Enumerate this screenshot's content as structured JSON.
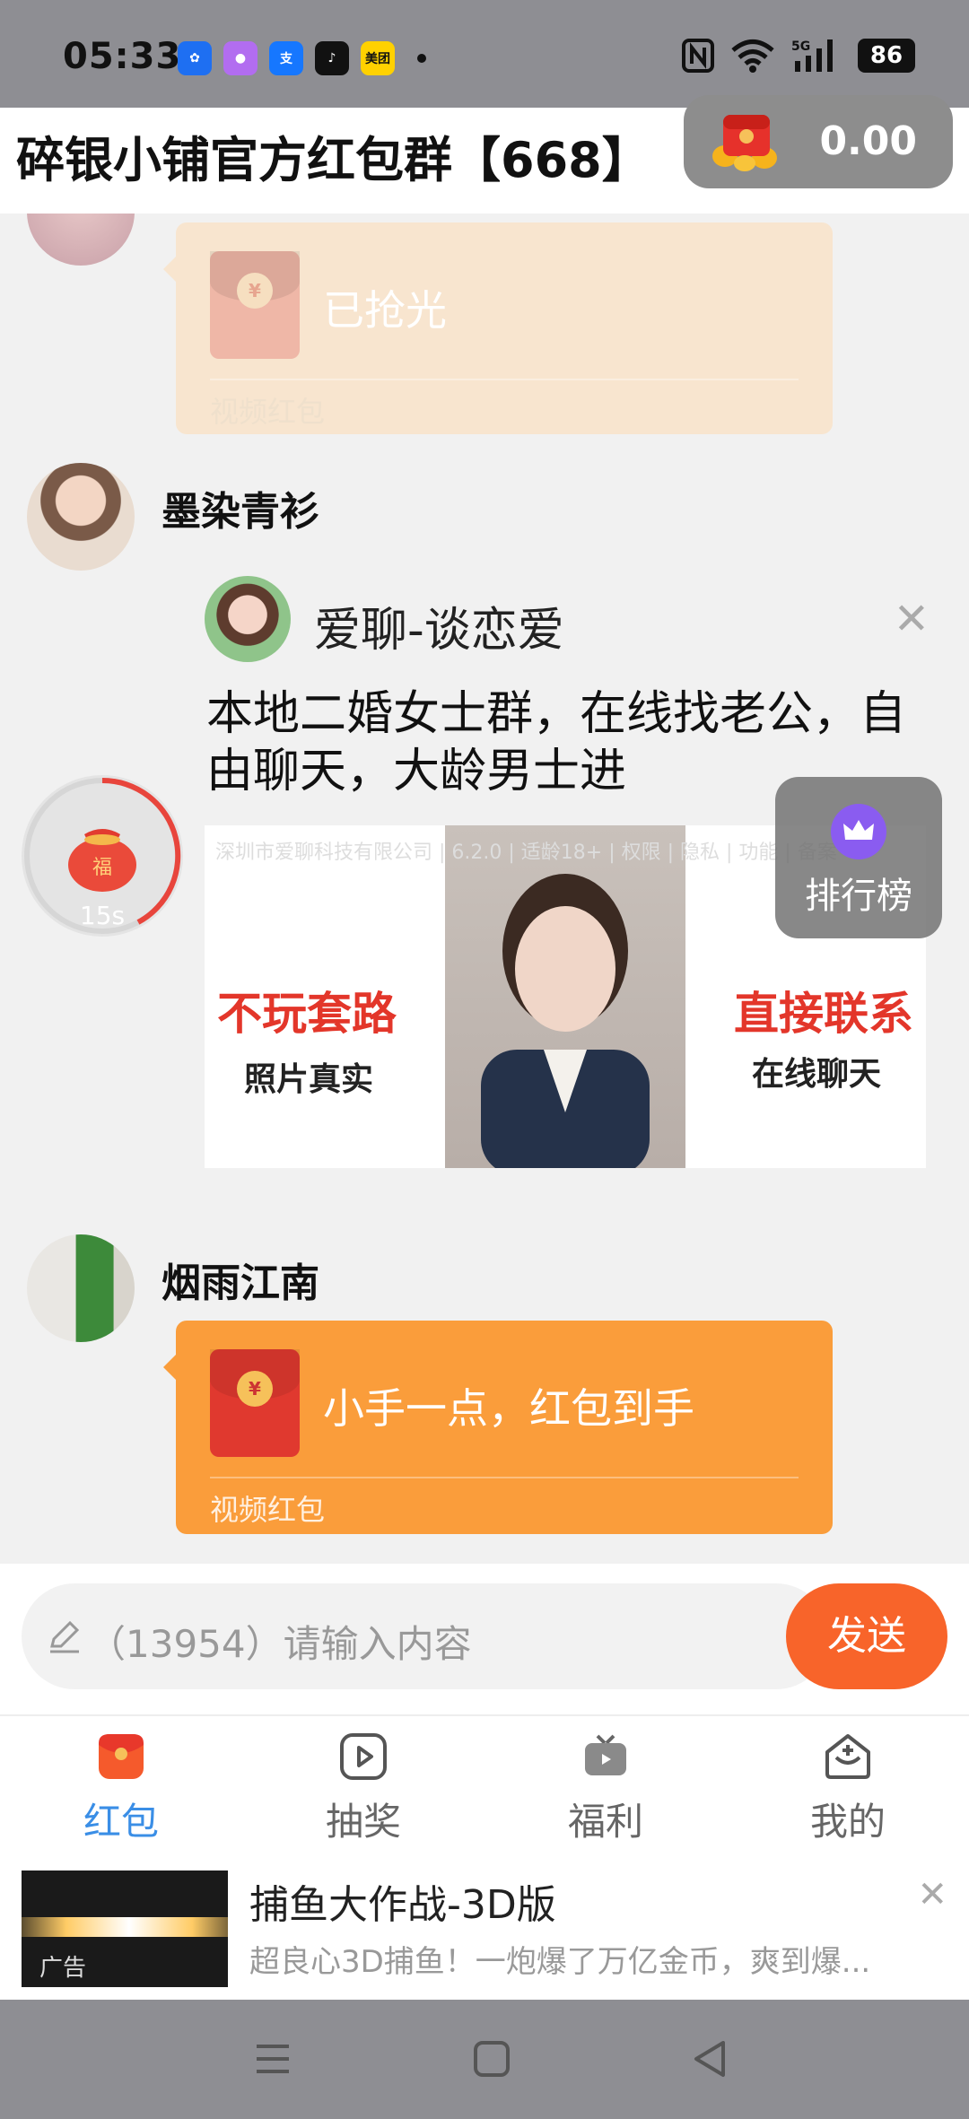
{
  "status": {
    "time": "05:33",
    "battery": "86",
    "apps": [
      {
        "name": "pinwheel-app-icon",
        "bg": "#1e6ff2",
        "glyph": "✿"
      },
      {
        "name": "photos-app-icon",
        "bg": "#b26df0",
        "glyph": "●"
      },
      {
        "name": "alipay-app-icon",
        "bg": "#1677ff",
        "glyph": "支"
      },
      {
        "name": "tiktok-app-icon",
        "bg": "#111111",
        "glyph": "♪"
      },
      {
        "name": "meituan-app-icon",
        "bg": "#ffd100",
        "glyph": "美团"
      }
    ]
  },
  "header": {
    "title": "碎银小铺官方红包群【668】",
    "balance": "0.00"
  },
  "messages": [
    {
      "status": "已抢光",
      "label": "视频红包"
    },
    {
      "sender": "墨染青衫"
    },
    {
      "sender": "烟雨江南",
      "text": "小手一点，红包到手",
      "label": "视频红包"
    }
  ],
  "ad": {
    "brand": "爱聊-谈恋爱",
    "headline": "本地二婚女士群，在线找老公，自由聊天，大龄男士进",
    "disclaimer": "深圳市爱聊科技有限公司 | 6.2.0 | 适龄18+ | 权限 | 隐私 | 功能 | 备案",
    "left_title": "不玩套路",
    "left_sub": "照片真实",
    "right_title": "直接联系",
    "right_sub": "在线聊天"
  },
  "widgets": {
    "timer": "15s",
    "rank": "排行榜"
  },
  "input": {
    "placeholder": "（13954）请输入内容",
    "send": "发送"
  },
  "tabs": [
    {
      "label": "红包"
    },
    {
      "label": "抽奖"
    },
    {
      "label": "福利"
    },
    {
      "label": "我的"
    }
  ],
  "bottom_ad": {
    "title": "捕鱼大作战-3D版",
    "desc": "超良心3D捕鱼！一炮爆了万亿金币，爽到爆...",
    "tag": "广告"
  },
  "colors": {
    "accent": "#f8642a",
    "card_orange": "#fa9d3b",
    "card_faded": "#f8e5cf",
    "tab_active": "#3a8ee6"
  }
}
